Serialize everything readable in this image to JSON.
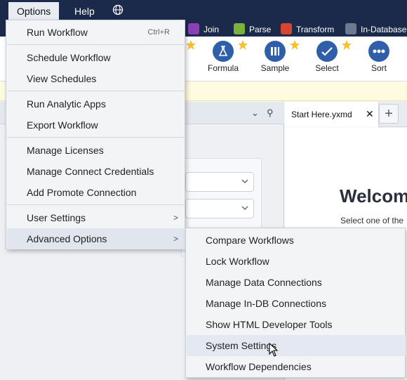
{
  "menubar": {
    "options": "Options",
    "help": "Help",
    "globe_icon": "globe-icon"
  },
  "categories": [
    {
      "label": "Join",
      "color": "#8d3fb7"
    },
    {
      "label": "Parse",
      "color": "#7ab13a"
    },
    {
      "label": "Transform",
      "color": "#d64532"
    },
    {
      "label": "In-Database",
      "color": "#6b7a92"
    }
  ],
  "tools": [
    "Formula",
    "Sample",
    "Select",
    "Sort"
  ],
  "colors": {
    "tool_icon": "#2f5fa8",
    "star": "#f6c12f",
    "menubar": "#1b2a4a"
  },
  "options_menu": {
    "run_workflow": "Run Workflow",
    "run_shortcut": "Ctrl+R",
    "schedule_workflow": "Schedule Workflow",
    "view_schedules": "View Schedules",
    "run_analytic_apps": "Run Analytic Apps",
    "export_workflow": "Export Workflow",
    "manage_licenses": "Manage Licenses",
    "manage_connect_credentials": "Manage Connect Credentials",
    "add_promote_connection": "Add Promote Connection",
    "user_settings": "User Settings",
    "advanced_options": "Advanced Options",
    "submenu_arrow": ">"
  },
  "advanced_submenu": [
    "Compare Workflows",
    "Lock Workflow",
    "Manage Data Connections",
    "Manage In-DB Connections",
    "Show HTML Developer Tools",
    "System Settings",
    "Workflow Dependencies"
  ],
  "tab": {
    "label": "Start Here.yxmd",
    "close": "✕",
    "add": "+"
  },
  "welcome": {
    "title": "Welcom",
    "subtitle": "Select one of the"
  }
}
